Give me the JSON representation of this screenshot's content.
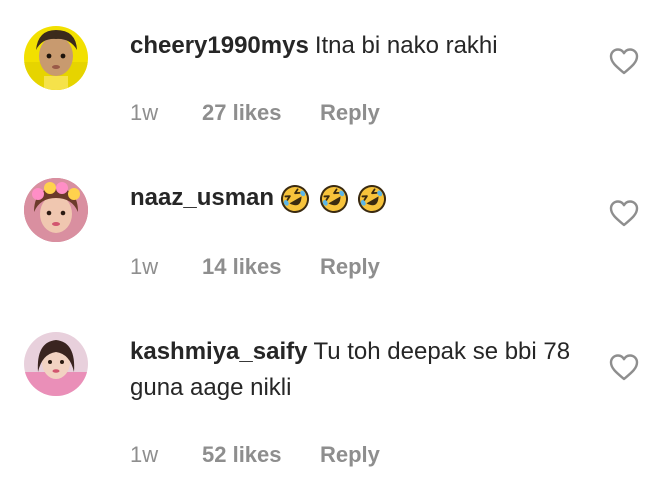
{
  "comments": [
    {
      "username": "cheery1990mys",
      "text": "Itna bi nako rakhi",
      "time": "1w",
      "likes": "27 likes",
      "reply": "Reply"
    },
    {
      "username": "naaz_usman",
      "text": "",
      "emojis": [
        "rolling-on-floor-laughing-emoji",
        "rolling-on-floor-laughing-emoji",
        "rolling-on-floor-laughing-emoji"
      ],
      "time": "1w",
      "likes": "14 likes",
      "reply": "Reply"
    },
    {
      "username": "kashmiya_saify",
      "text": "Tu toh deepak se bbi 78 guna aage nikli",
      "time": "1w",
      "likes": "52 likes",
      "reply": "Reply"
    }
  ],
  "icons": {
    "like": "heart-outline-icon"
  },
  "colors": {
    "text": "#262626",
    "secondary": "#8e8e8e",
    "emoji_face": "#f7c33b"
  }
}
